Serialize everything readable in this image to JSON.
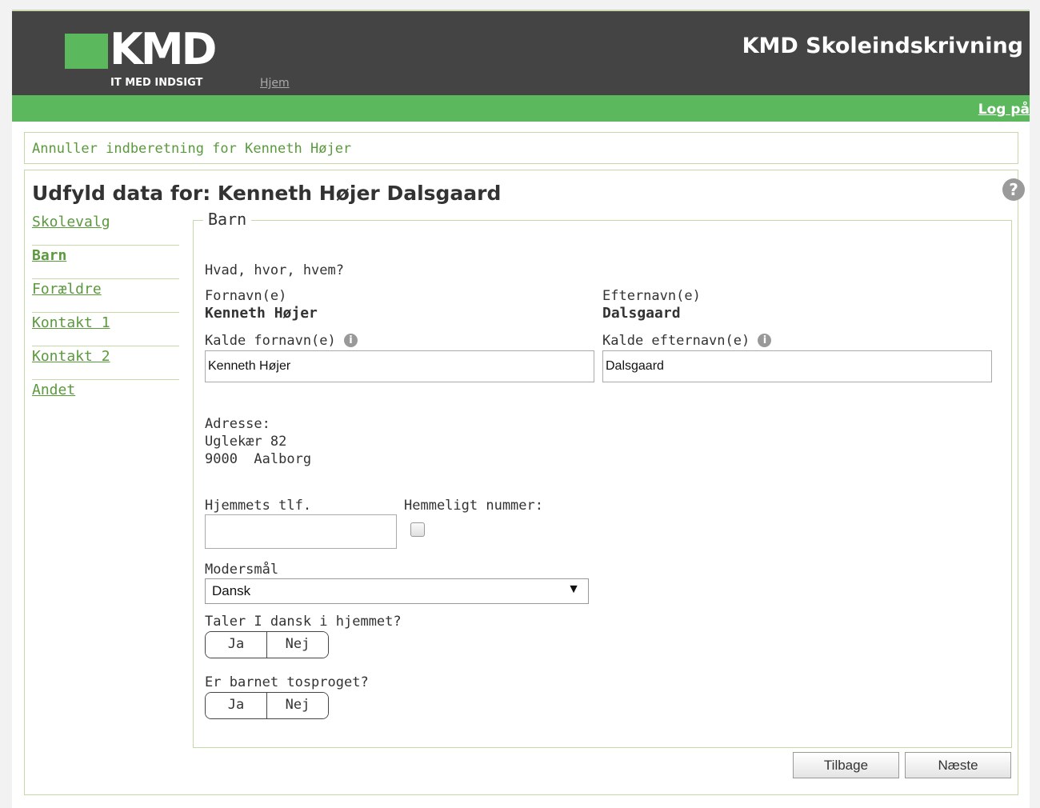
{
  "header": {
    "logo_text": "KMD",
    "logo_subtitle": "IT MED INDSIGT",
    "nav_home": "Hjem",
    "app_title": "KMD Skoleindskrivning",
    "logout": "Log på"
  },
  "cancel_link": "Annuller indberetning for Kenneth Højer",
  "page_title": "Udfyld data for: Kenneth Højer Dalsgaard",
  "sidenav": [
    {
      "label": "Skolevalg"
    },
    {
      "label": "Barn"
    },
    {
      "label": "Forældre"
    },
    {
      "label": "Kontakt 1"
    },
    {
      "label": "Kontakt 2"
    },
    {
      "label": "Andet"
    }
  ],
  "form": {
    "legend": "Barn",
    "intro": "Hvad, hvor, hvem?",
    "first_name_label": "Fornavn(e)",
    "first_name_value": "Kenneth Højer",
    "last_name_label": "Efternavn(e)",
    "last_name_value": "Dalsgaard",
    "call_first_label": "Kalde fornavn(e)",
    "call_first_value": "Kenneth Højer",
    "call_last_label": "Kalde efternavn(e)",
    "call_last_value": "Dalsgaard",
    "address_label": "Adresse:",
    "address_line1": "Uglekær 82",
    "address_line2": "9000  Aalborg",
    "home_phone_label": "Hjemmets tlf.",
    "home_phone_value": "",
    "secret_label": "Hemmeligt nummer:",
    "mother_tongue_label": "Modersmål",
    "mother_tongue_value": "Dansk",
    "speaks_danish_label": "Taler I dansk i hjemmet?",
    "bilingual_label": "Er barnet tosproget?",
    "yes": "Ja",
    "no": "Nej"
  },
  "buttons": {
    "back": "Tilbage",
    "next": "Næste"
  },
  "colors": {
    "header_bg": "#444444",
    "accent_green": "#5cb85c",
    "link_green": "#5a9a3c",
    "border_green": "#c5d9a8"
  }
}
